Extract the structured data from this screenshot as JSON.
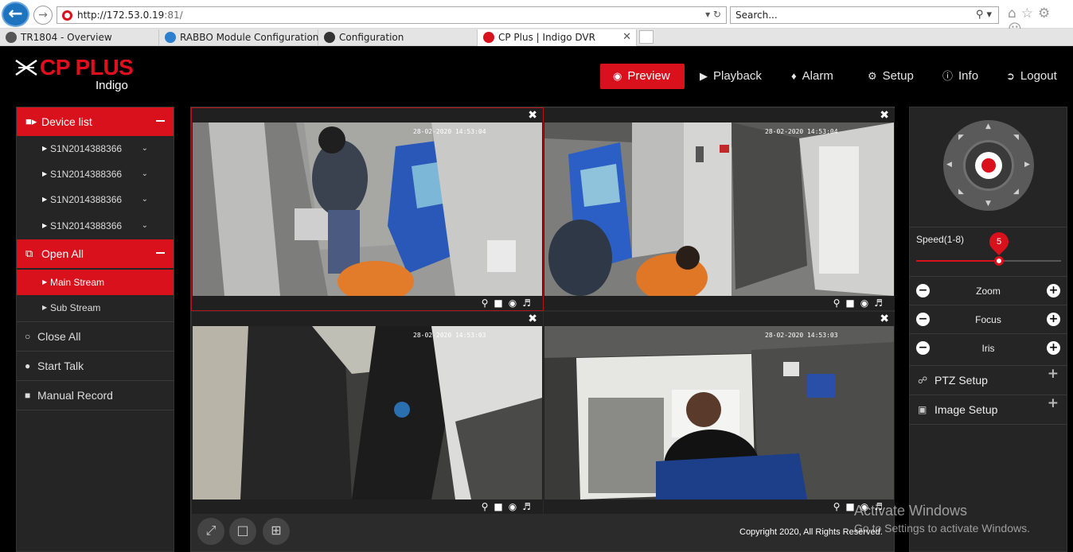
{
  "browser": {
    "url": "http://172.53.0.19:81/",
    "url_host": "http://172.53.0.19",
    "url_port": ":81/",
    "search_placeholder": "Search...",
    "tabs": [
      {
        "label": "TR1804 - Overview",
        "icon": "camera-icon"
      },
      {
        "label": "RABBO Module Configuration",
        "icon": "ie-icon"
      },
      {
        "label": "Configuration",
        "icon": "webcam-icon"
      },
      {
        "label": "CP Plus | Indigo DVR",
        "icon": "cpplus-icon",
        "active": true
      }
    ]
  },
  "brand": {
    "name": "CP PLUS",
    "sub": "Indigo",
    "color": "#d8111c"
  },
  "nav": {
    "preview": "Preview",
    "playback": "Playback",
    "alarm": "Alarm",
    "setup": "Setup",
    "info": "Info",
    "logout": "Logout"
  },
  "sidebar": {
    "device_list": "Device list",
    "devices": [
      "S1N2014388366",
      "S1N2014388366",
      "S1N2014388366",
      "S1N2014388366"
    ],
    "open_all": "Open All",
    "main_stream": "Main Stream",
    "sub_stream": "Sub Stream",
    "close_all": "Close All",
    "start_talk": "Start Talk",
    "manual_record": "Manual Record"
  },
  "cameras": [
    {
      "timestamp": "28-02-2020 14:53:04"
    },
    {
      "timestamp": "28-02-2020 14:53:04"
    },
    {
      "timestamp": "28-02-2020 14:53:03"
    },
    {
      "timestamp": "28-02-2020 14:53:03"
    }
  ],
  "footer": {
    "copyright": "Copyright 2020, All Rights Reserved."
  },
  "ptz": {
    "speed_label": "Speed(1-8)",
    "speed_value": "5",
    "speed_fraction": 0.57,
    "zoom": "Zoom",
    "focus": "Focus",
    "iris": "Iris",
    "ptz_setup": "PTZ Setup",
    "image_setup": "Image Setup"
  },
  "os_watermark": {
    "line1": "Activate Windows",
    "line2": "Go to Settings to activate Windows."
  }
}
